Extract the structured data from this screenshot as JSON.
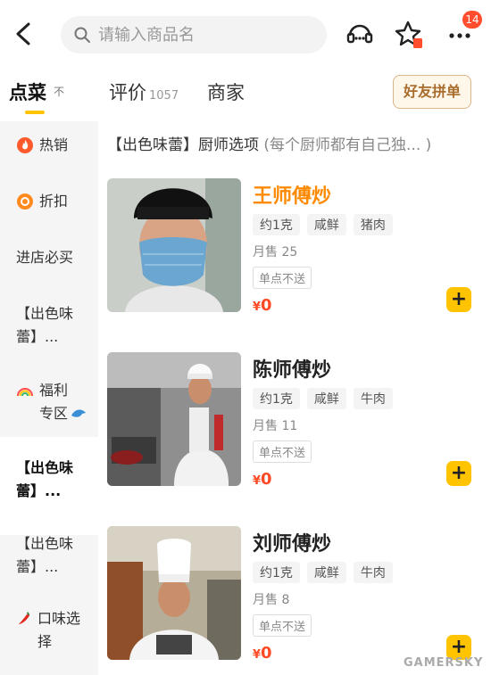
{
  "header": {
    "search_placeholder": "请输入商品名",
    "cart_badge": "14",
    "icons": [
      "back-arrow-icon",
      "search-icon",
      "customer-service-icon",
      "favorite-star-icon",
      "more-dots-icon"
    ]
  },
  "tabs": {
    "order": {
      "label": "点菜",
      "sub": "不"
    },
    "review": {
      "label": "评价",
      "count": "1057"
    },
    "merchant": {
      "label": "商家"
    },
    "friend_button": "好友拼单",
    "accent_color": "#ffc300"
  },
  "sidebar": {
    "items": [
      {
        "label": "热销",
        "icon": "hot-flame-icon"
      },
      {
        "label": "折扣",
        "icon": "discount-icon"
      },
      {
        "label": "进店必买"
      },
      {
        "label": "【出色味蕾】..."
      },
      {
        "label": "福利专区",
        "icon": "rainbow-icon",
        "trail_icon": "dolphin-icon"
      },
      {
        "label": "【出色味蕾】...",
        "active": true
      },
      {
        "label": "【出色味蕾】..."
      },
      {
        "label": "口味选择",
        "icon": "chili-pepper-icon"
      }
    ]
  },
  "section": {
    "title": "【出色味蕾】厨师选项",
    "description": "(每个厨师都有自己独... )"
  },
  "dishes": [
    {
      "name": "王师傅炒",
      "tags": [
        "约1克",
        "咸鲜",
        "猪肉"
      ],
      "sold": "月售 25",
      "note": "单点不送",
      "currency": "¥",
      "price": "0",
      "photo": "chef-with-mask-photo"
    },
    {
      "name": "陈师傅炒",
      "tags": [
        "约1克",
        "咸鲜",
        "牛肉"
      ],
      "sold": "月售 11",
      "note": "单点不送",
      "currency": "¥",
      "price": "0",
      "photo": "chef-in-kitchen-photo"
    },
    {
      "name": "刘师傅炒",
      "tags": [
        "约1克",
        "咸鲜",
        "牛肉"
      ],
      "sold": "月售 8",
      "note": "单点不送",
      "currency": "¥",
      "price": "0",
      "photo": "chef-in-white-hat-photo"
    }
  ],
  "add_button_label": "+",
  "price_color": "#ff4a26",
  "watermark": "GAMERSKY"
}
